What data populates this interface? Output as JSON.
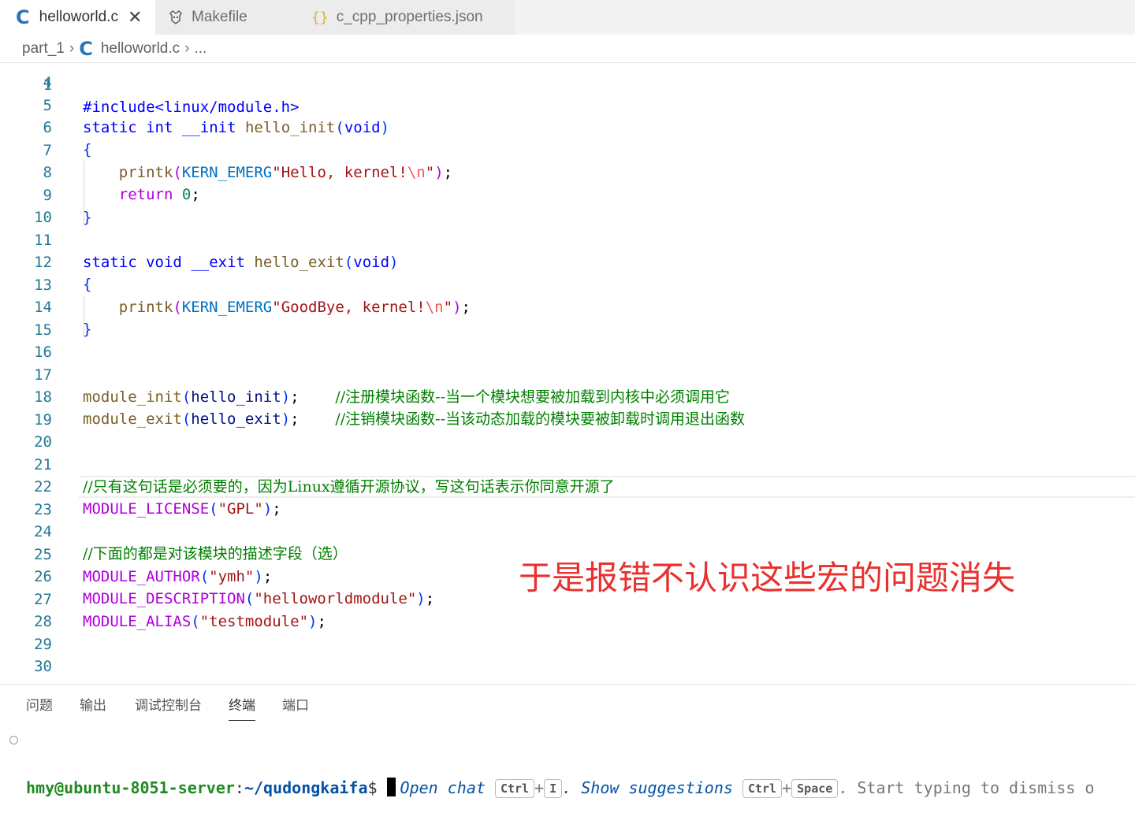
{
  "tabs": [
    {
      "label": "helloworld.c",
      "icon": "c-language-icon",
      "active": true
    },
    {
      "label": "Makefile",
      "icon": "makefile-icon",
      "active": false
    },
    {
      "label": "c_cpp_properties.json",
      "icon": "json-braces-icon",
      "active": false
    }
  ],
  "tab_close": "✕",
  "breadcrumb": {
    "folder": "part_1",
    "file": "helloworld.c",
    "more": "..."
  },
  "editor": {
    "cut_line": "#include<linux/module.h>",
    "lines": [
      {
        "n": "4"
      },
      {
        "n": "5"
      },
      {
        "n": "6"
      },
      {
        "n": "7"
      },
      {
        "n": "8"
      },
      {
        "n": "9"
      },
      {
        "n": "10"
      },
      {
        "n": "11"
      },
      {
        "n": "12"
      },
      {
        "n": "13"
      },
      {
        "n": "14"
      },
      {
        "n": "15"
      },
      {
        "n": "16"
      },
      {
        "n": "17"
      },
      {
        "n": "18"
      },
      {
        "n": "19"
      },
      {
        "n": "20"
      },
      {
        "n": "21"
      },
      {
        "n": "22"
      },
      {
        "n": "23"
      },
      {
        "n": "24"
      },
      {
        "n": "25"
      },
      {
        "n": "26"
      },
      {
        "n": "27"
      },
      {
        "n": "28"
      },
      {
        "n": "29"
      },
      {
        "n": "30"
      }
    ],
    "code": {
      "l6_kw1": "static",
      "l6_kw2": "int",
      "l6_mac": "__init",
      "l6_fn": "hello_init",
      "l6_kw3": "void",
      "l7": "{",
      "l8_fn": "printk",
      "l8_mac": "KERN_EMERG",
      "l8_str1": "\"Hello, kernel!",
      "l8_esc": "\\n",
      "l8_str2": "\"",
      "l9_kw": "return",
      "l9_num": "0",
      "l10": "}",
      "l12_kw1": "static",
      "l12_kw2": "void",
      "l12_mac": "__exit",
      "l12_fn": "hello_exit",
      "l12_kw3": "void",
      "l13": "{",
      "l14_fn": "printk",
      "l14_mac": "KERN_EMERG",
      "l14_str1": "\"GoodBye, kernel!",
      "l14_esc": "\\n",
      "l14_str2": "\"",
      "l15": "}",
      "l18_fn": "module_init",
      "l18_arg": "hello_init",
      "l18_cm": "//注册模块函数--当一个模块想要被加载到内核中必须调用它",
      "l19_fn": "module_exit",
      "l19_arg": "hello_exit",
      "l19_cm": "//注销模块函数--当该动态加载的模块要被卸载时调用退出函数",
      "l22_cm": "//只有这句话是必须要的，因为Linux遵循开源协议，写这句话表示你同意开源了",
      "l23_mac": "MODULE_LICENSE",
      "l23_str": "\"GPL\"",
      "l25_cm": "//下面的都是对该模块的描述字段（选）",
      "l26_mac": "MODULE_AUTHOR",
      "l26_str": "\"ymh\"",
      "l27_mac": "MODULE_DESCRIPTION",
      "l27_str": "\"helloworldmodule\"",
      "l28_mac": "MODULE_ALIAS",
      "l28_str": "\"testmodule\""
    }
  },
  "annotation": "于是报错不认识这些宏的问题消失",
  "panel": {
    "tabs": [
      "问题",
      "输出",
      "调试控制台",
      "终端",
      "端口"
    ],
    "active_tab": "终端",
    "terminal": {
      "user_host": "hmy@ubuntu-8051-server",
      "colon": ":",
      "path": "~/qudongkaifa",
      "dollar": "$",
      "hint1": "Open chat",
      "key_ctrl": "Ctrl",
      "plus": "+",
      "key_i": "I",
      "hint2": ". Show suggestions",
      "key_space": "Space",
      "hint3": ". Start typing to dismiss o"
    }
  },
  "colors": {
    "keyword": "#0000ff",
    "function": "#795e26",
    "string": "#a31515",
    "comment": "#008000",
    "macro": "#af00db",
    "line_number": "#237893",
    "annotation": "#e8312f"
  }
}
